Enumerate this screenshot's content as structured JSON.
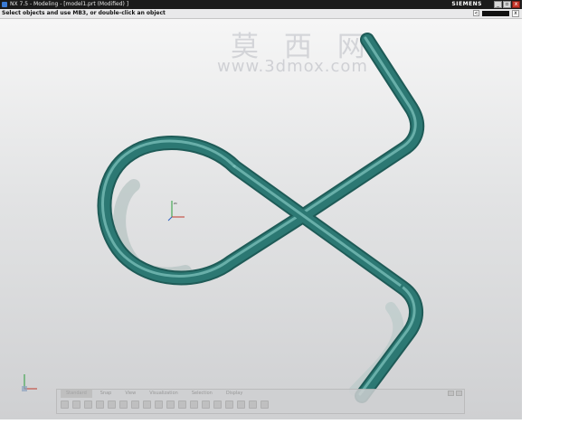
{
  "window": {
    "title": "NX 7.5 - Modeling - [model1.prt (Modified) ]",
    "brand": "SIEMENS",
    "controls": {
      "minimize": "_",
      "restore": "▫",
      "close": "x"
    }
  },
  "cue_line": {
    "text": "Select objects and use MB3, or double-click an object",
    "close": "x",
    "arrow": "<"
  },
  "watermark": {
    "chinese": "莫 西 网",
    "url": "www.3dmox.com"
  },
  "triad": {
    "label": "ZC"
  },
  "part": {
    "color": "#2c7873",
    "highlight": "#8fd0c9",
    "shadow": "#9fb5b5"
  },
  "resource_bar": {
    "tabs": [
      "Standard",
      "Snap",
      "View",
      "Visualization",
      "Selection",
      "Display"
    ]
  }
}
